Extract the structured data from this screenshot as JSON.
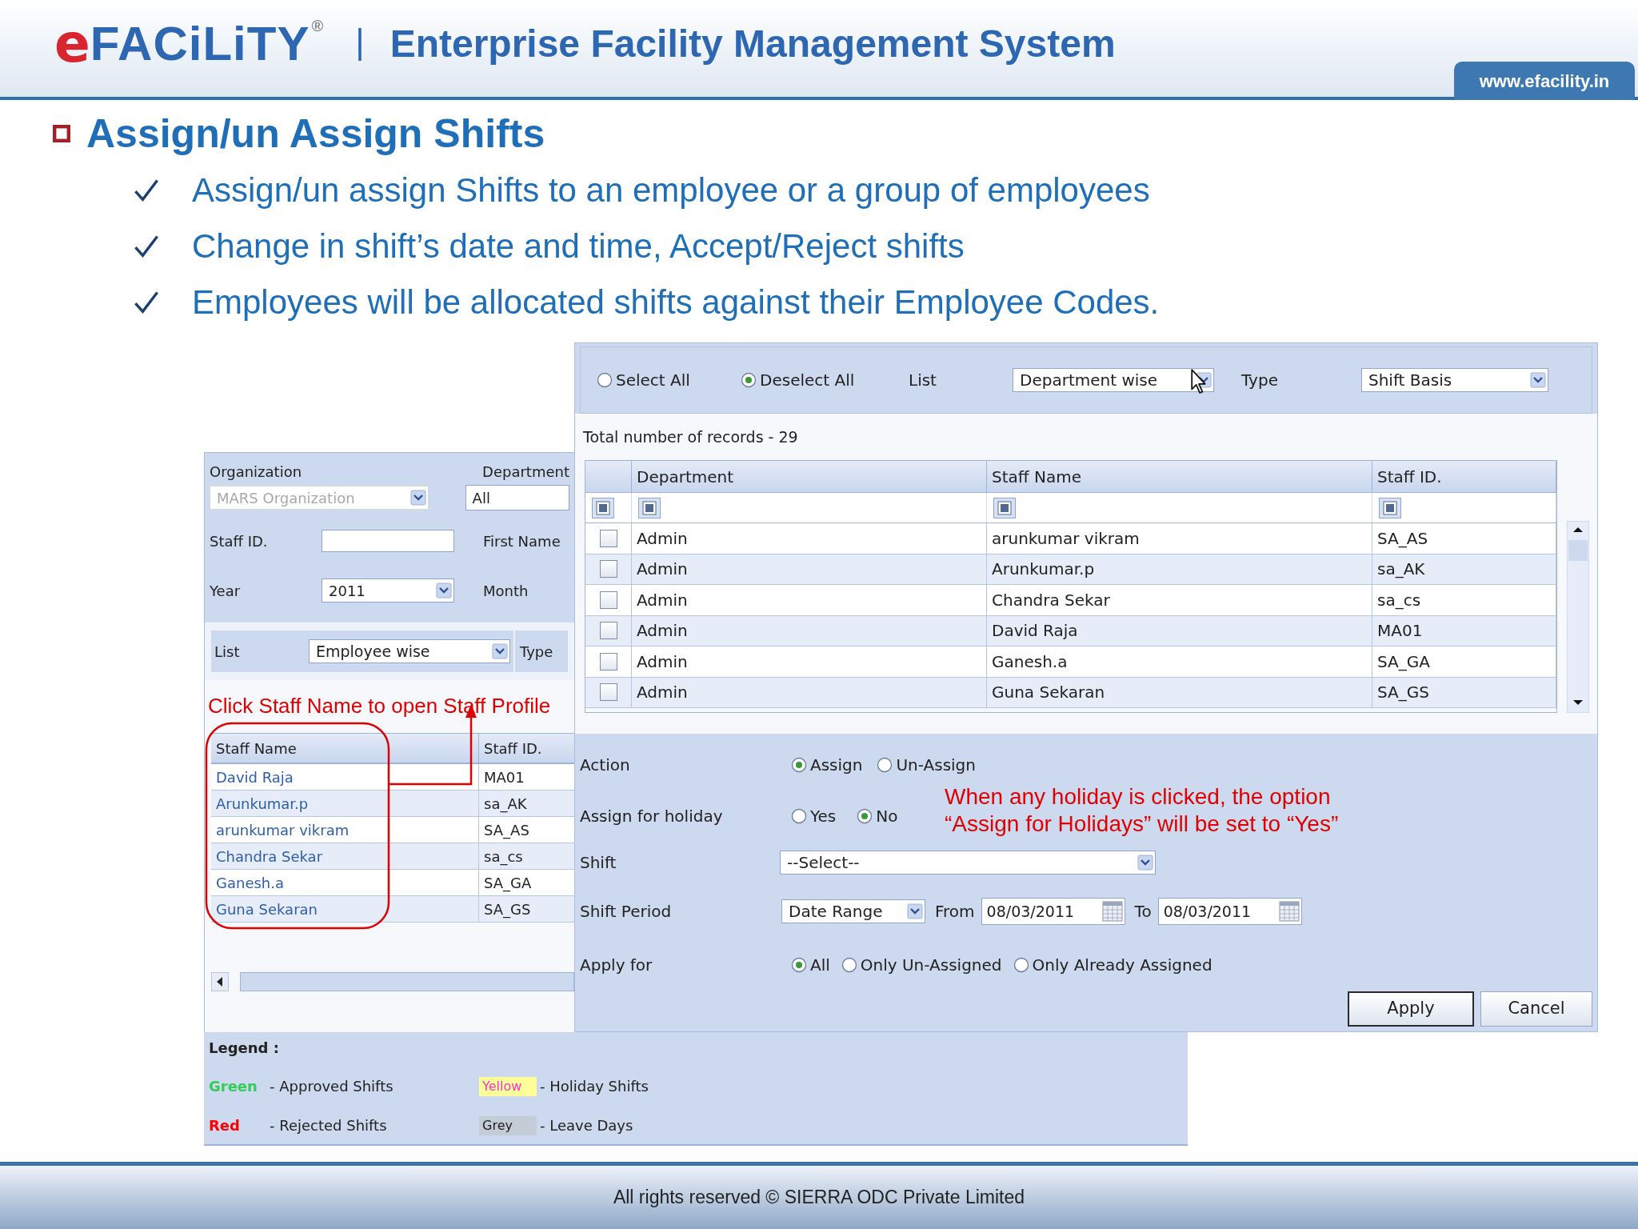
{
  "header": {
    "logo_first": "e",
    "logo_rest": "FACiLiTY",
    "registered": "®",
    "divider": "|",
    "title": "Enterprise Facility Management System",
    "url": "www.efacility.in"
  },
  "slide_title": "Assign/un Assign Shifts",
  "bullets": [
    "Assign/un assign Shifts to an employee or a group of employees",
    "Change in shift’s date and time, Accept/Reject shifts",
    "Employees will be allocated shifts against their Employee Codes."
  ],
  "search_panel": {
    "organization_label": "Organization",
    "organization": {
      "value": "MARS Organization",
      "disabled": true
    },
    "department_label": "Department",
    "department": "All",
    "staff_id_label": "Staff ID.",
    "first_name_label": "First Name",
    "year_label": "Year",
    "year": "2011",
    "month_label": "Month",
    "list_label": "List",
    "list": "Employee wise",
    "type_label": "Type",
    "note": "Click Staff Name to open Staff Profile",
    "table": {
      "columns": [
        "Staff Name",
        "Staff ID."
      ],
      "rows": [
        {
          "staff_name": "David Raja",
          "staff_id": "MA01"
        },
        {
          "staff_name": "Arunkumar.p",
          "staff_id": "sa_AK"
        },
        {
          "staff_name": "arunkumar vikram",
          "staff_id": "SA_AS"
        },
        {
          "staff_name": "Chandra Sekar",
          "staff_id": "sa_cs"
        },
        {
          "staff_name": "Ganesh.a",
          "staff_id": "SA_GA"
        },
        {
          "staff_name": "Guna Sekaran",
          "staff_id": "SA_GS"
        }
      ]
    }
  },
  "legend": {
    "title": "Legend :",
    "items": [
      {
        "kind": "text",
        "label": "Green",
        "color": "#33cc55",
        "text": "- Approved Shifts"
      },
      {
        "kind": "highlight",
        "label": "Yellow",
        "color": "#ffff99",
        "text": "- Holiday Shifts"
      },
      {
        "kind": "text",
        "label": "Red",
        "color": "#ff0000",
        "text": "- Rejected Shifts"
      },
      {
        "kind": "swatch",
        "label": "Grey",
        "color": "#c4ccd8",
        "text": "- Leave Days"
      }
    ]
  },
  "assign_panel": {
    "selection": [
      {
        "label": "Select All",
        "selected": false
      },
      {
        "label": "Deselect All",
        "selected": true
      }
    ],
    "list_label": "List",
    "list": "Department wise",
    "type_label": "Type",
    "type": "Shift Basis",
    "records": "Total number of records - 29",
    "grid": {
      "columns": [
        "Department",
        "Staff Name",
        "Staff ID."
      ],
      "rows": [
        {
          "checked": false,
          "department": "Admin",
          "staff_name": "arunkumar vikram",
          "staff_id": "SA_AS"
        },
        {
          "checked": false,
          "department": "Admin",
          "staff_name": "Arunkumar.p",
          "staff_id": "sa_AK"
        },
        {
          "checked": false,
          "department": "Admin",
          "staff_name": "Chandra Sekar",
          "staff_id": "sa_cs"
        },
        {
          "checked": false,
          "department": "Admin",
          "staff_name": "David Raja",
          "staff_id": "MA01"
        },
        {
          "checked": false,
          "department": "Admin",
          "staff_name": "Ganesh.a",
          "staff_id": "SA_GA"
        },
        {
          "checked": false,
          "department": "Admin",
          "staff_name": "Guna Sekaran",
          "staff_id": "SA_GS"
        }
      ]
    },
    "action_label": "Action",
    "action": [
      {
        "label": "Assign",
        "selected": true
      },
      {
        "label": "Un-Assign",
        "selected": false
      }
    ],
    "holiday_label": "Assign for holiday",
    "holiday": [
      {
        "label": "Yes",
        "selected": false
      },
      {
        "label": "No",
        "selected": true
      }
    ],
    "note": [
      "When any holiday is clicked, the option",
      "“Assign for Holidays” will be set to “Yes”"
    ],
    "shift_label": "Shift",
    "shift": "--Select--",
    "period_label": "Shift Period",
    "period": "Date Range",
    "from_label": "From",
    "from": "08/03/2011",
    "to_label": "To",
    "to": "08/03/2011",
    "apply_label": "Apply for",
    "apply_for": [
      {
        "label": "All",
        "selected": true
      },
      {
        "label": "Only Un-Assigned",
        "selected": false
      },
      {
        "label": "Only Already Assigned",
        "selected": false
      }
    ],
    "buttons": [
      "Apply",
      "Cancel"
    ]
  },
  "footer": "All rights reserved © SIERRA ODC Private Limited"
}
